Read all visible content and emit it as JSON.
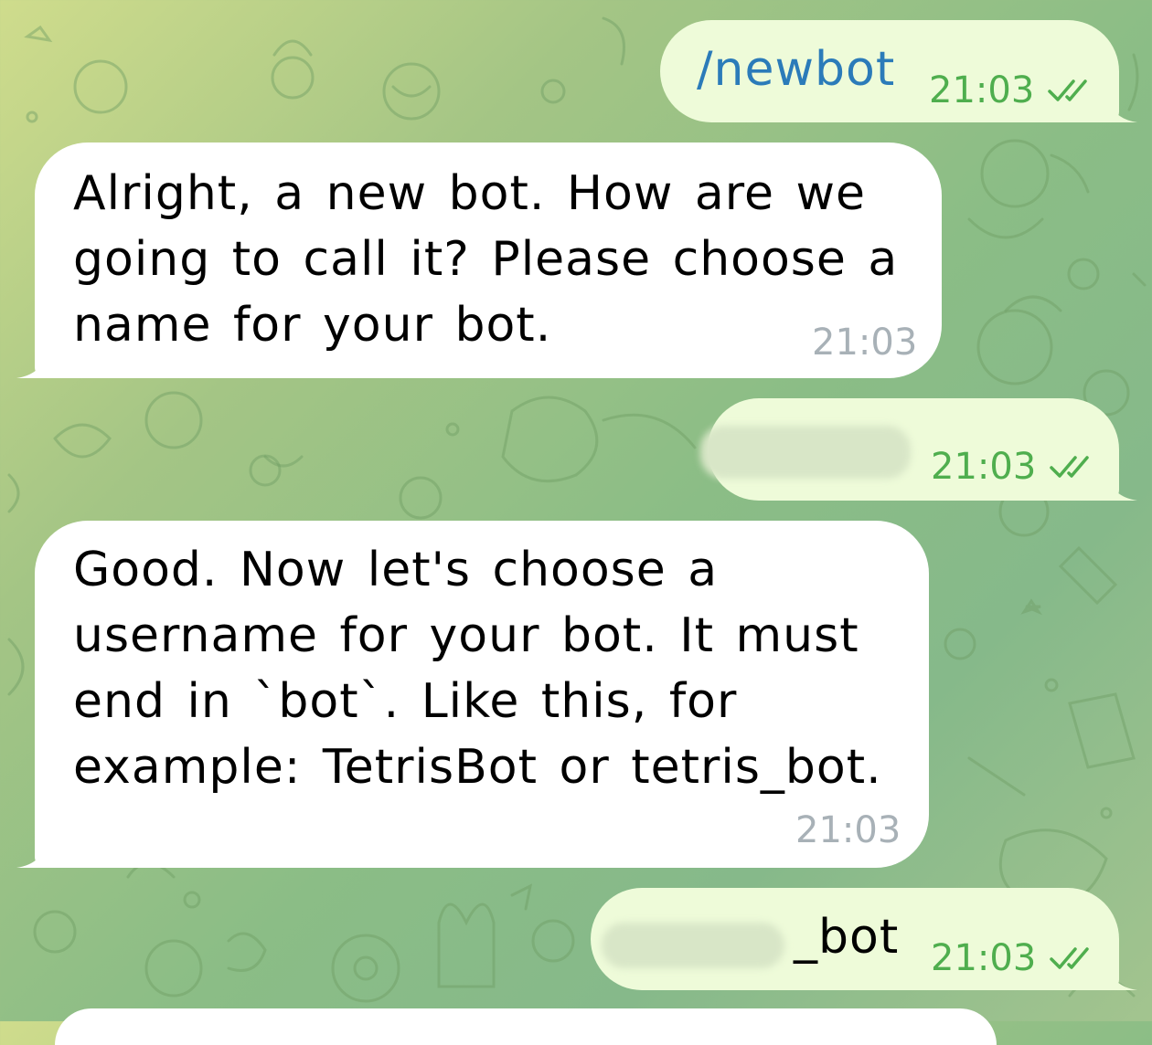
{
  "colors": {
    "outgoing_bubble": "#eefbd9",
    "incoming_bubble": "#ffffff",
    "outgoing_time": "#4fae4e",
    "incoming_time": "#a8b1b7",
    "command_link": "#2b7bb9"
  },
  "messages": [
    {
      "direction": "outgoing",
      "text": "/newbot",
      "is_command": true,
      "time": "21:03",
      "status_icon": "double-check-icon"
    },
    {
      "direction": "incoming",
      "lines": [
        "Alright, a new bot. How are we",
        "going to call it? Please choose a",
        "name for your bot."
      ],
      "time": "21:03"
    },
    {
      "direction": "outgoing",
      "text": "",
      "redacted": true,
      "time": "21:03",
      "status_icon": "double-check-icon"
    },
    {
      "direction": "incoming",
      "lines": [
        "Good. Now let's choose a",
        "username for your bot. It must",
        "end in `bot`. Like this, for",
        "example: TetrisBot or tetris_bot."
      ],
      "time": "21:03"
    },
    {
      "direction": "outgoing",
      "text": "_bot",
      "redacted": true,
      "time": "21:03",
      "status_icon": "double-check-icon"
    }
  ]
}
